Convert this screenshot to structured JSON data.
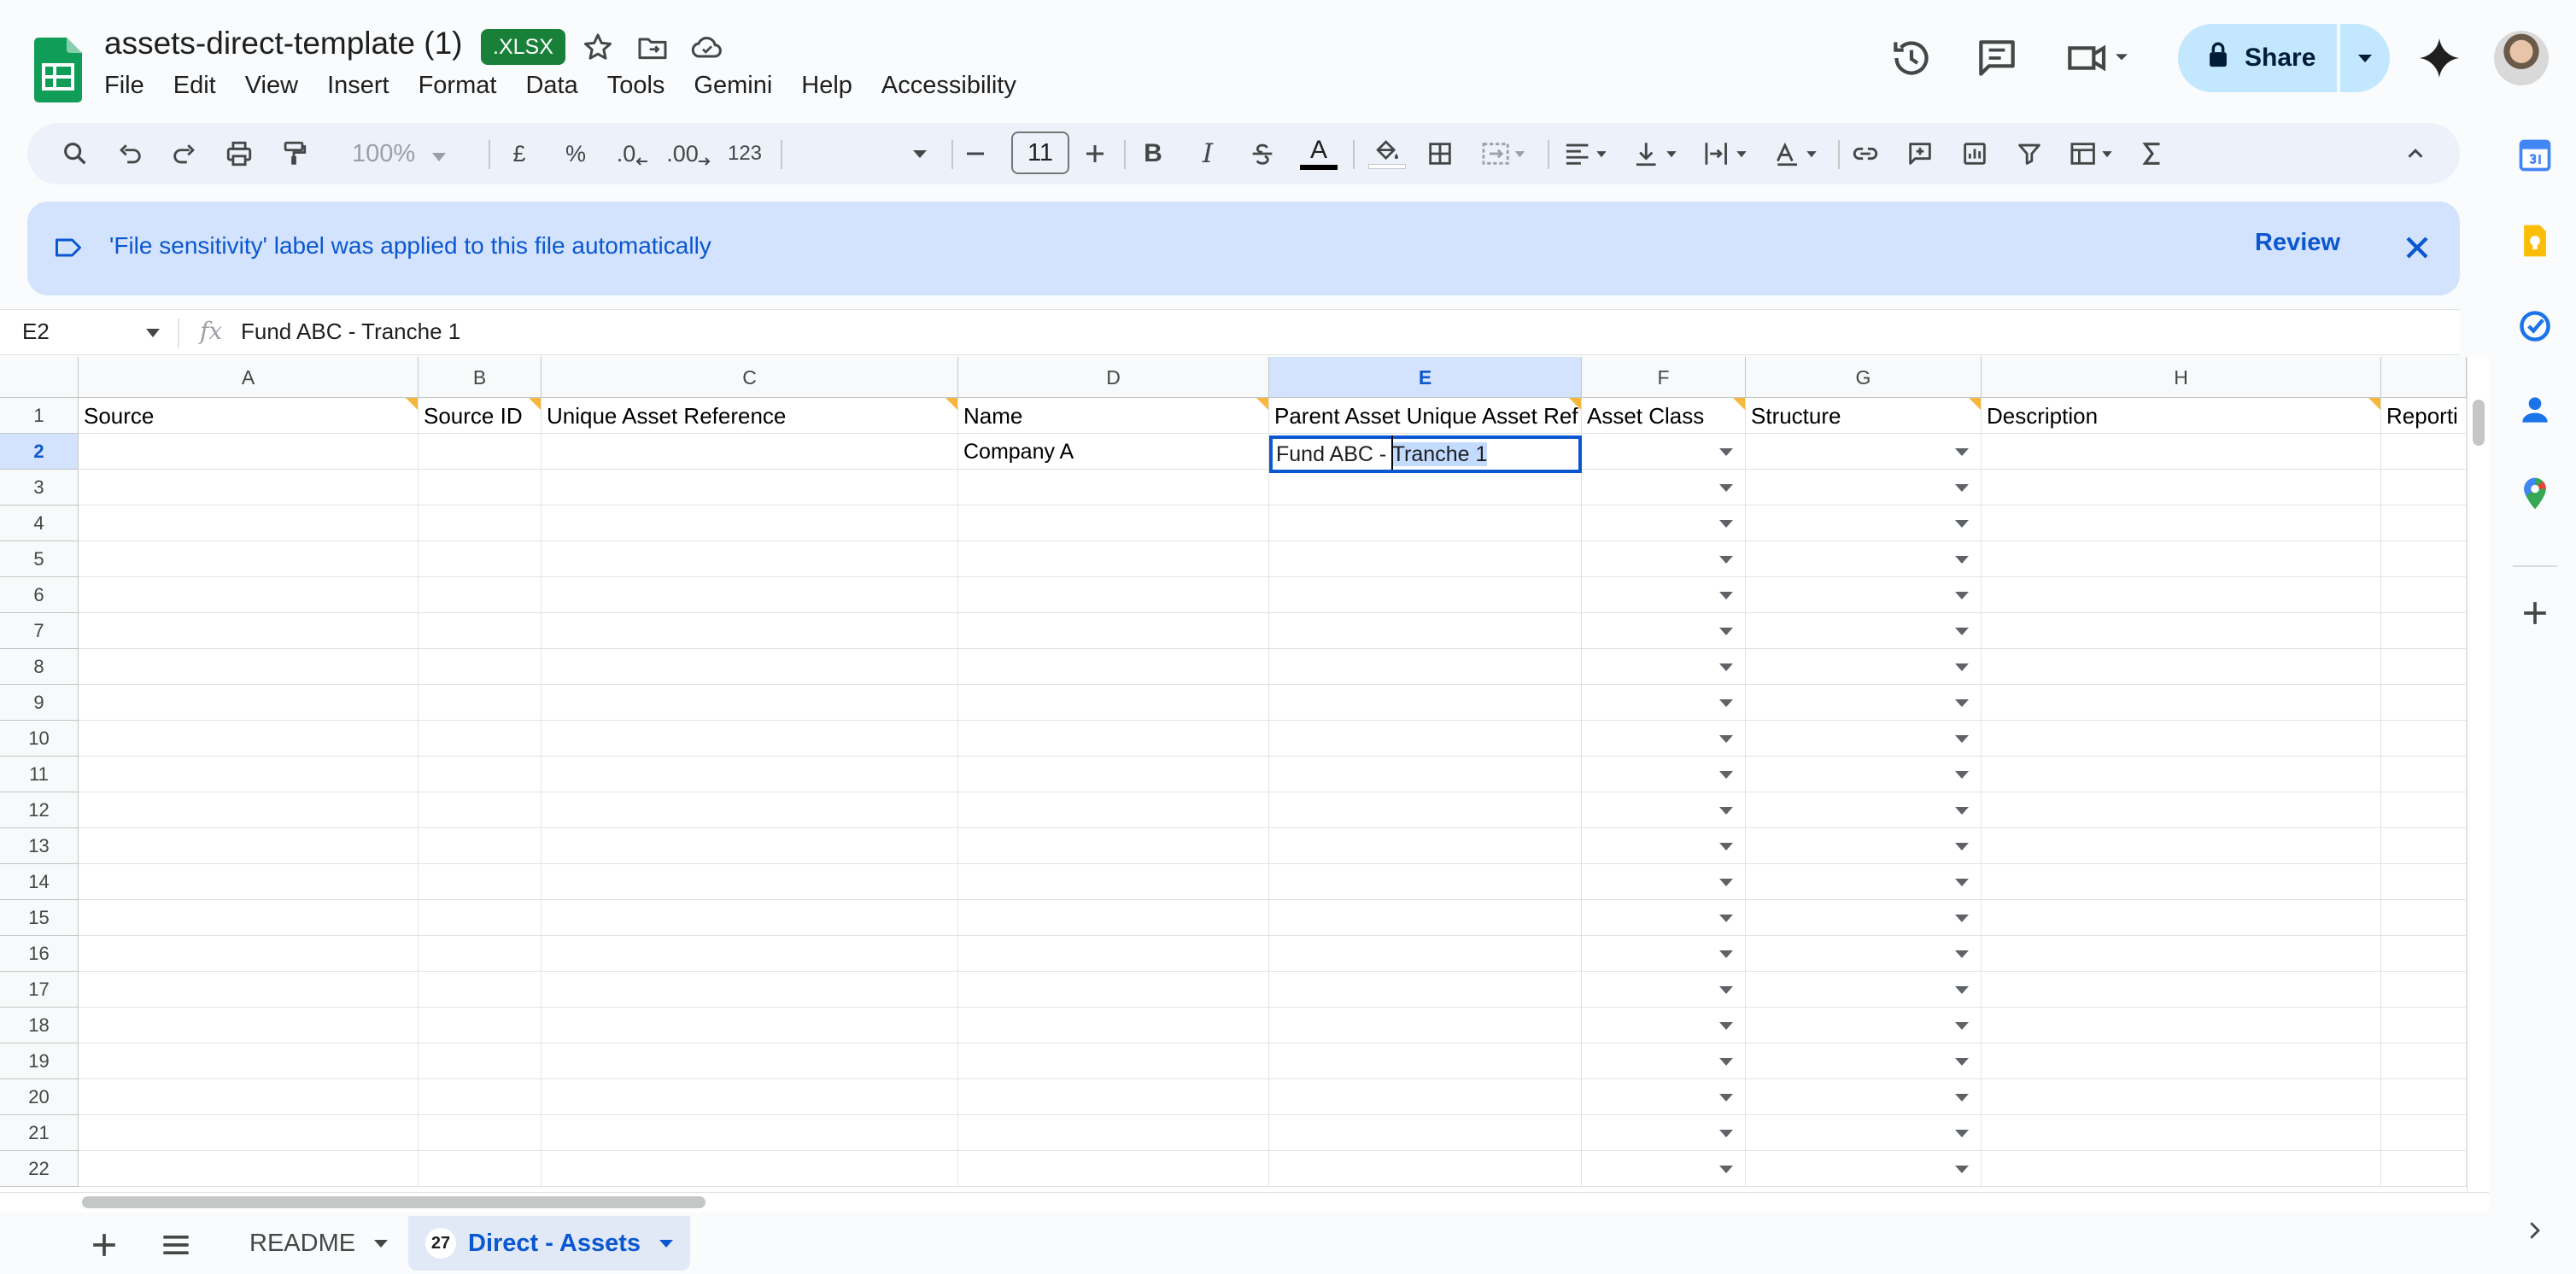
{
  "document": {
    "title": "assets-direct-template (1)",
    "file_type_badge": ".XLSX"
  },
  "menu": [
    "File",
    "Edit",
    "View",
    "Insert",
    "Format",
    "Data",
    "Tools",
    "Gemini",
    "Help",
    "Accessibility"
  ],
  "header": {
    "share_label": "Share"
  },
  "toolbar": {
    "zoom": "100%",
    "currency": "£",
    "percent": "%",
    "decrease_decimal": ".0",
    "increase_decimal": ".00",
    "number_format": "123",
    "font_size": "11",
    "bold": "B",
    "italic": "I",
    "text_color_letter": "A"
  },
  "banner": {
    "message": "'File sensitivity' label was applied to this file automatically",
    "action_label": "Review"
  },
  "formula_bar": {
    "cell_ref": "E2",
    "fx": "fx",
    "content": "Fund ABC - Tranche 1"
  },
  "grid": {
    "columns": [
      "A",
      "B",
      "C",
      "D",
      "E",
      "F",
      "G",
      "H"
    ],
    "selected_column": "E",
    "rows": [
      "1",
      "2",
      "3",
      "4",
      "5",
      "6",
      "7",
      "8",
      "9",
      "10",
      "11",
      "12",
      "13",
      "14",
      "15",
      "16",
      "17",
      "18",
      "19",
      "20",
      "21",
      "22"
    ],
    "selected_row": "2",
    "header_row": [
      "Source",
      "Source ID",
      "Unique Asset Reference",
      "Name",
      "Parent Asset Unique Asset Ref",
      "Asset Class",
      "Structure",
      "Description",
      "Reporti"
    ],
    "row2": {
      "D": "Company A",
      "E_before_selection": "Fund ABC - ",
      "E_selected": "Tranche 1"
    }
  },
  "sheets": {
    "tabs": [
      {
        "label": "README"
      },
      {
        "label": "Direct - Assets",
        "badge": "27",
        "active": true
      }
    ]
  },
  "colors": {
    "accent": "#0b57d0",
    "share_bg": "#c2e7ff",
    "banner_bg": "#d3e3fd",
    "xlsx_badge": "#188038",
    "note_triangle": "#f6b73c"
  }
}
